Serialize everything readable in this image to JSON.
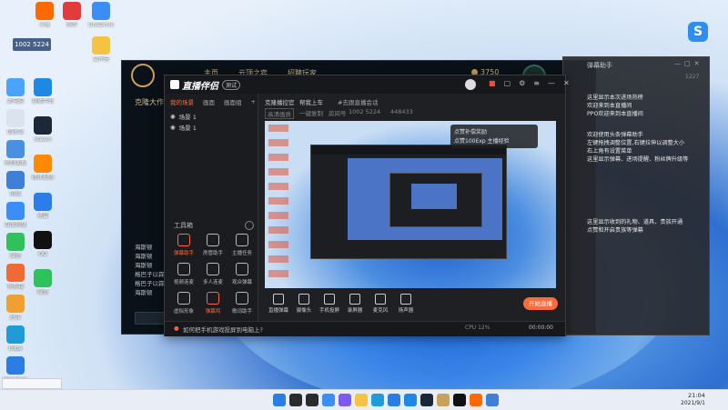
{
  "desktop": {
    "icons_left": [
      {
        "label": "此电脑",
        "icon": "computer-icon",
        "color": "#4aa3ff"
      },
      {
        "label": "回收站",
        "icon": "recycle-bin-icon",
        "color": "#d9e4ef"
      },
      {
        "label": "控制面板",
        "icon": "control-panel-icon",
        "color": "#4a90e2"
      },
      {
        "label": "网络",
        "icon": "network-icon",
        "color": "#3f7fd8"
      },
      {
        "label": "百度网盘",
        "icon": "cloud-icon",
        "color": "#3a8ef6"
      },
      {
        "label": "微信",
        "icon": "wechat-icon",
        "color": "#2fc25b"
      },
      {
        "label": "快剪辑",
        "icon": "scissors-icon",
        "color": "#f06a35"
      },
      {
        "label": "好压",
        "icon": "archive-icon",
        "color": "#f0a030"
      },
      {
        "label": "Edge",
        "icon": "edge-icon",
        "color": "#1f9bd8"
      },
      {
        "label": "Windows",
        "icon": "windows-icon",
        "color": "#2a7de1"
      }
    ],
    "icons_col2": [
      {
        "label": "直播伴侣",
        "icon": "live-icon",
        "color": "#1e88e5"
      },
      {
        "label": "Steam",
        "icon": "steam-icon",
        "color": "#1b2838"
      },
      {
        "label": "腾讯视频",
        "icon": "video-icon",
        "color": "#ff8a00"
      },
      {
        "label": "迅雷",
        "icon": "thunder-icon",
        "color": "#2b7de9"
      },
      {
        "label": "QQ",
        "icon": "qq-icon",
        "color": "#111"
      },
      {
        "label": "微信",
        "icon": "wechat-icon",
        "color": "#2fc25b"
      }
    ],
    "top_row": [
      {
        "label": "斗鱼",
        "icon": "app-icon",
        "color": "#ff6a00"
      },
      {
        "label": "快手",
        "icon": "app-icon",
        "color": "#e23b3b"
      },
      {
        "label": "OneDrive",
        "icon": "onedrive-icon",
        "color": "#3a8ef6"
      },
      {
        "label": "文件夹",
        "icon": "folder-icon",
        "color": "#f5c342"
      }
    ],
    "id_overlay": "1002 5224"
  },
  "game_window": {
    "title": "克隆大作战",
    "coins": "3750",
    "tabs": [
      "主页",
      "云顶之弈",
      "招聘玩家"
    ],
    "chat_lines": [
      "海斯顿",
      "海斯顿",
      "海斯顿",
      "格巴子以霖",
      "格巴子以霖",
      "海斯顿"
    ]
  },
  "companion": {
    "logo": "直播伴侣",
    "logo_badge": "测试",
    "left_tabs": [
      "我的场景",
      "画面",
      "画面组"
    ],
    "scene_items": [
      "场景 1",
      "场景 1"
    ],
    "tools_header": "工具箱",
    "tools": [
      {
        "label": "弹幕助手",
        "icon": "danmaku-icon",
        "active": true
      },
      {
        "label": "房管助手",
        "icon": "admin-icon",
        "active": false
      },
      {
        "label": "主播任务",
        "icon": "task-icon",
        "active": false
      },
      {
        "label": "视频连麦",
        "icon": "call-icon",
        "active": false
      },
      {
        "label": "多人连麦",
        "icon": "multi-call-icon",
        "active": false
      },
      {
        "label": "观众弹幕",
        "icon": "audience-icon",
        "active": false
      },
      {
        "label": "虚拟形象",
        "icon": "avatar-icon",
        "active": false
      },
      {
        "label": "弹幕鸡",
        "icon": "chicken-icon",
        "active": true
      },
      {
        "label": "歌词助手",
        "icon": "lyrics-icon",
        "active": false
      }
    ],
    "hint": "如何把手机游戏投屏到电脑上?",
    "header_title": "克隆播控官",
    "header_sub": "帮我上车",
    "header_tag": "#去跟直播会话",
    "room_id": "1002 5224",
    "room_label": "房间号",
    "tag2": "高清画质",
    "tag3": "一键复制",
    "num1": "448433",
    "promo_line1": "点赞补偿奖励",
    "promo_line2": "点赞100Exp 主播经验",
    "controls": [
      {
        "label": "直播弹幕",
        "icon": "danmaku-icon"
      },
      {
        "label": "摄像头",
        "icon": "camera-icon"
      },
      {
        "label": "手机投屏",
        "icon": "phone-cast-icon"
      },
      {
        "label": "录屏器",
        "icon": "screen-record-icon"
      },
      {
        "label": "麦克风",
        "icon": "mic-icon"
      },
      {
        "label": "扬声器",
        "icon": "speaker-icon"
      }
    ],
    "start_button": "开始直播",
    "status": "CPU 12%",
    "timer": "00:00:00"
  },
  "danmaku_panel": {
    "title": "弹幕助手",
    "lines": [
      "这里显示本次进场热榜",
      "欢迎来到本直播间",
      "PPO欢迎来到本直播间",
      "欢迎使用头条弹幕助手",
      "左键拖拽调整位置,右键拉伸以调整大小",
      "右上角有设置菜单",
      "这里显示弹幕、进场提醒、粉丝牌升级等",
      "这里显示收到的礼物、道具、贵族开通",
      "点赞和开启贵族等弹幕"
    ],
    "top_count": "1227"
  },
  "taskbar": {
    "icons": [
      {
        "name": "windows-start-icon",
        "color": "#2a7de1"
      },
      {
        "name": "search-icon",
        "color": "#2b2b2b"
      },
      {
        "name": "task-view-icon",
        "color": "#2b2b2b"
      },
      {
        "name": "widgets-icon",
        "color": "#3a8ef6"
      },
      {
        "name": "chat-icon",
        "color": "#7a5af0"
      },
      {
        "name": "file-explorer-icon",
        "color": "#f5c342"
      },
      {
        "name": "edge-icon",
        "color": "#1f9bd8"
      },
      {
        "name": "store-icon",
        "color": "#2a7de1"
      },
      {
        "name": "live-companion-icon",
        "color": "#1e88e5"
      },
      {
        "name": "steam-icon",
        "color": "#1b2838"
      },
      {
        "name": "game-icon",
        "color": "#c8a15a"
      },
      {
        "name": "qq-icon",
        "color": "#111"
      },
      {
        "name": "app-icon",
        "color": "#ff6a00"
      },
      {
        "name": "browser-icon",
        "color": "#3f7fd8"
      }
    ],
    "time": "21:04",
    "date": "2021/9/1"
  },
  "notification_bar": ""
}
